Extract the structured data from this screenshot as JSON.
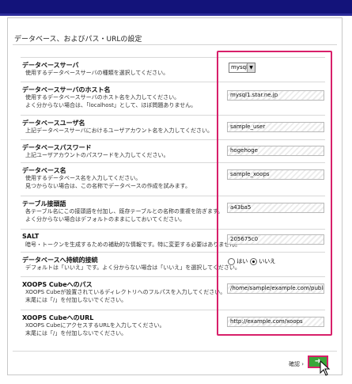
{
  "section_title": "データベース、およびパス・URLの設定",
  "rows": [
    {
      "label": "データベースサーバ",
      "desc": [
        "使用するデータベースサーバの種類を選択してください。"
      ],
      "value": "mysql"
    },
    {
      "label": "データベースサーバのホスト名",
      "desc": [
        "使用するデータベースサーバのホスト名を入力してください。",
        "よく分からない場合は、「localhost」として、ほぼ問題ありません。"
      ],
      "value": "mysql1.star.ne.jp"
    },
    {
      "label": "データベースユーザ名",
      "desc": [
        "上記データベースサーバにおけるユーザアカウント名を入力してください。"
      ],
      "value": "sample_user"
    },
    {
      "label": "データベースパスワード",
      "desc": [
        "上記ユーザアカウントのパスワードを入力してください。"
      ],
      "value": "hogehoge"
    },
    {
      "label": "データベース名",
      "desc": [
        "使用するデータベース名を入力してください。",
        "見つからない場合は、この名称でデータベースの作成を試みます。"
      ],
      "value": "sample_xoops"
    },
    {
      "label": "テーブル接頭語",
      "desc": [
        "各テーブル名にこの接頭語を付加し、既存テーブルとの名称の重複を防ぎます。",
        "よく分からない場合はデフォルトのままにしておいてください。"
      ],
      "value": "a43ba5"
    },
    {
      "label": "SALT",
      "desc": [
        "暗号・トークンを生成するための補助的な情報です。特に変更する必要はありません。"
      ],
      "value": "205675c0"
    },
    {
      "label": "データベースへ持続的接続",
      "desc": [
        "デフォルトは「いいえ」です。よく分からない場合は「いいえ」を選択してください。"
      ],
      "yes": "はい",
      "no": "いいえ"
    },
    {
      "label": "XOOPS Cubeへのパス",
      "desc": [
        "XOOPS Cubeが設置されているディレクトリへのフルパスを入力してください。",
        "末尾には「/」を付加しないでください。"
      ],
      "value": "/home/sample/example.com/public_html"
    },
    {
      "label": "XOOPS CubeへのURL",
      "desc": [
        "XOOPS CubeにアクセスするURLを入力してください。",
        "末尾には「/」を付加しないでください。"
      ],
      "value": "http://example.com/xoops"
    }
  ],
  "footer": {
    "confirm": "確認 ›",
    "next_icon": "arrow-right"
  },
  "colors": {
    "header": "#13137a",
    "highlight": "#d8206a",
    "next_button": "#3aa63a"
  }
}
